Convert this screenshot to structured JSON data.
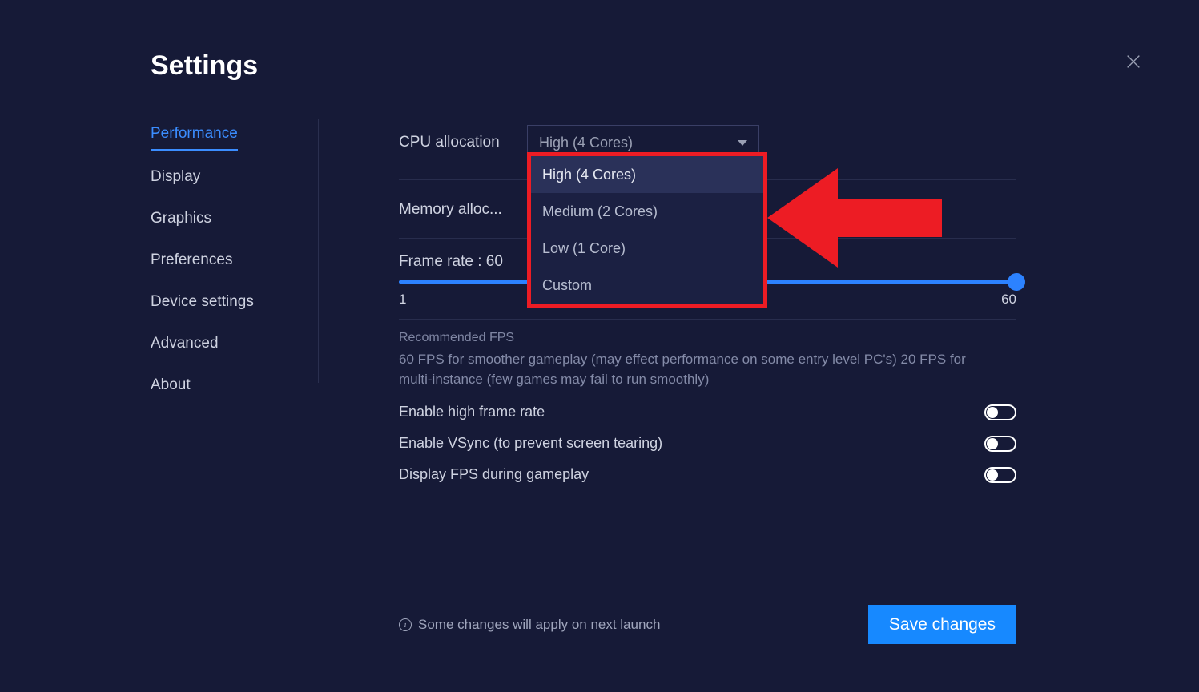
{
  "title": "Settings",
  "sidebar": {
    "items": [
      {
        "label": "Performance",
        "active": true
      },
      {
        "label": "Display",
        "active": false
      },
      {
        "label": "Graphics",
        "active": false
      },
      {
        "label": "Preferences",
        "active": false
      },
      {
        "label": "Device settings",
        "active": false
      },
      {
        "label": "Advanced",
        "active": false
      },
      {
        "label": "About",
        "active": false
      }
    ]
  },
  "cpu": {
    "label": "CPU allocation",
    "selected": "High (4 Cores)",
    "options": [
      "High (4 Cores)",
      "Medium (2 Cores)",
      "Low (1 Core)",
      "Custom"
    ]
  },
  "memory": {
    "label": "Memory alloc..."
  },
  "framerate": {
    "label": "Frame rate : 60",
    "min": "1",
    "max": "60",
    "value": 60
  },
  "recommended": {
    "heading": "Recommended FPS",
    "text": "60 FPS for smoother gameplay (may effect performance on some entry level PC's) 20 FPS for multi-instance (few games may fail to run smoothly)"
  },
  "toggles": {
    "high_frame": {
      "label": "Enable high frame rate",
      "on": false
    },
    "vsync": {
      "label": "Enable VSync (to prevent screen tearing)",
      "on": false
    },
    "display_fps": {
      "label": "Display FPS during gameplay",
      "on": false
    }
  },
  "footer": {
    "note": "Some changes will apply on next launch",
    "save": "Save changes"
  },
  "colors": {
    "accent": "#1789ff",
    "annotation": "#ed1c24",
    "bg": "#161a37"
  }
}
